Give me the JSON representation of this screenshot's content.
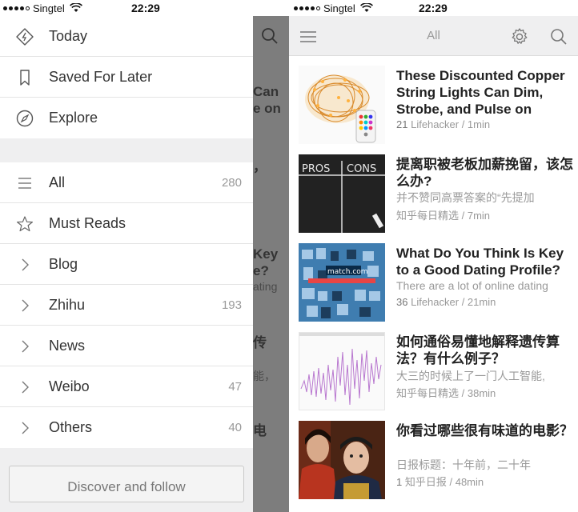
{
  "status_left": {
    "carrier": "Singtel",
    "time": "22:29"
  },
  "status_right": {
    "carrier": "Singtel",
    "time": "22:29"
  },
  "drawer": {
    "top_items": [
      {
        "label": "Today",
        "icon": "today-diamond-icon"
      },
      {
        "label": "Saved For Later",
        "icon": "bookmark-icon"
      },
      {
        "label": "Explore",
        "icon": "compass-icon"
      }
    ],
    "feed_items": [
      {
        "label": "All",
        "count": "280",
        "icon": "list-icon"
      },
      {
        "label": "Must Reads",
        "count": "",
        "icon": "star-icon"
      },
      {
        "label": "Blog",
        "count": "",
        "icon": "chevron-right-icon"
      },
      {
        "label": "Zhihu",
        "count": "193",
        "icon": "chevron-right-icon"
      },
      {
        "label": "News",
        "count": "",
        "icon": "chevron-right-icon"
      },
      {
        "label": "Weibo",
        "count": "47",
        "icon": "chevron-right-icon"
      },
      {
        "label": "Others",
        "count": "40",
        "icon": "chevron-right-icon"
      }
    ],
    "discover_label": "Discover and follow"
  },
  "behind": {
    "fragments": [
      "Can",
      "e on",
      "，",
      "Key",
      "e?",
      "ating",
      "传",
      "能，",
      "电"
    ]
  },
  "navbar": {
    "title": "All"
  },
  "articles": [
    {
      "title": "These Discounted Copper String Lights Can Dim, Strobe, and Pulse on",
      "summary": "",
      "count": "21",
      "source": "Lifehacker",
      "age": "1min",
      "thumb": "string-lights-thumbnail"
    },
    {
      "title": "提离职被老板加薪挽留，该怎么办?",
      "summary": "并不赞同高票答案的“先提加",
      "count": "",
      "source": "知乎每日精选",
      "age": "7min",
      "thumb": "pros-cons-chalkboard-thumbnail"
    },
    {
      "title": "What Do You Think Is Key to a Good Dating Profile?",
      "summary": "There are a lot of online dating",
      "count": "36",
      "source": "Lifehacker",
      "age": "21min",
      "thumb": "dating-site-wall-thumbnail"
    },
    {
      "title": "如何通俗易懂地解释遗传算法？有什么例子？",
      "summary": "大三的时候上了一门人工智能,",
      "count": "",
      "source": "知乎每日精选",
      "age": "38min",
      "thumb": "waveform-plot-thumbnail"
    },
    {
      "title": "你看过哪些很有味道的电影？",
      "summary": "日报标题：十年前，二十年",
      "count": "1",
      "source": "知乎日报",
      "age": "48min",
      "thumb": "movie-still-thumbnail"
    }
  ]
}
